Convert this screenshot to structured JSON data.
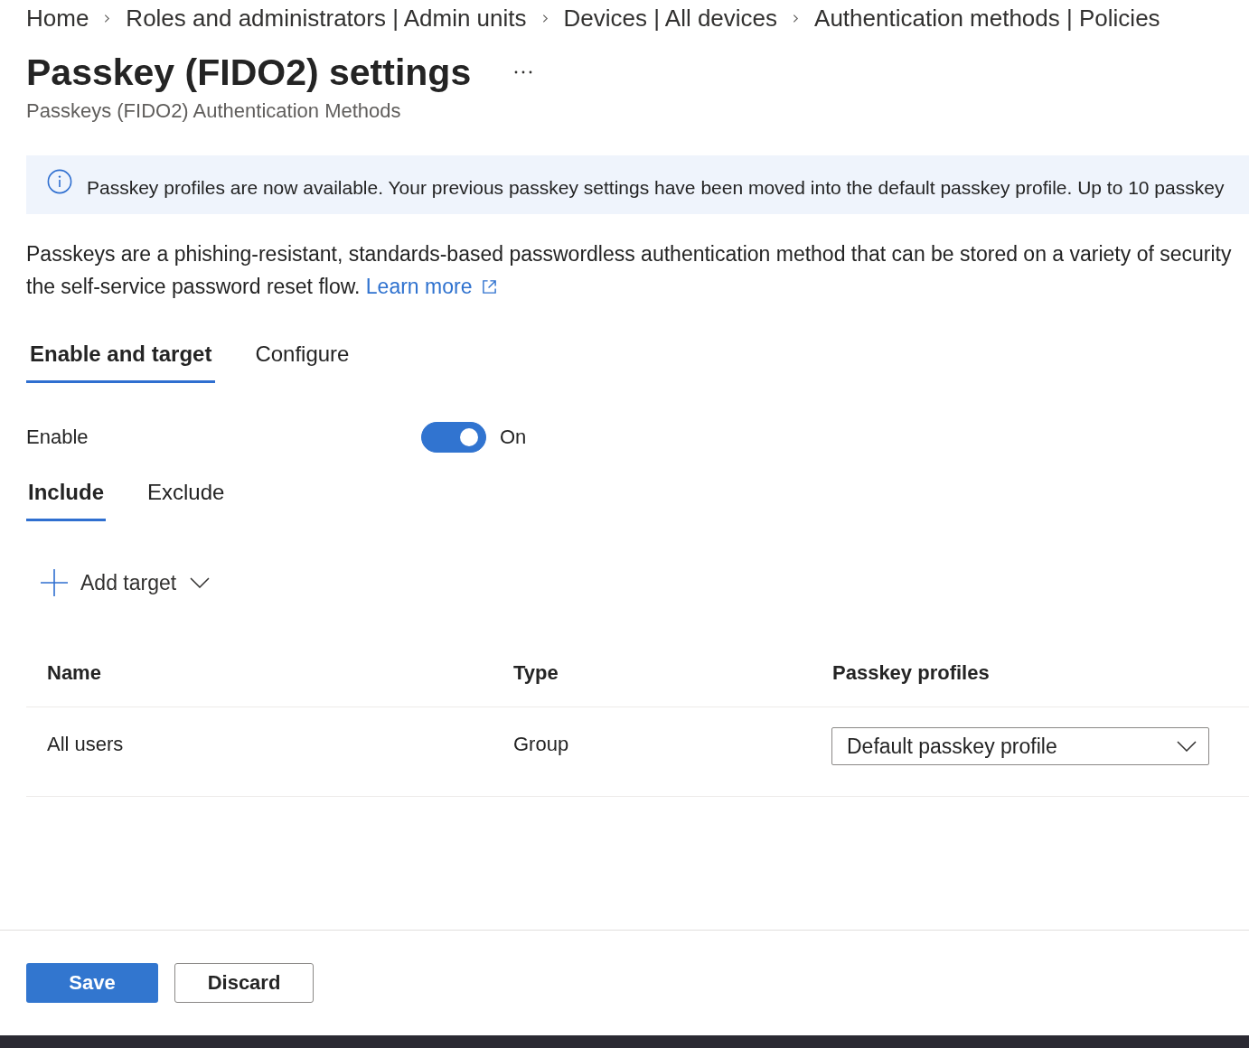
{
  "breadcrumb": [
    "Home",
    "Roles and administrators | Admin units",
    "Devices | All devices",
    "Authentication methods | Policies"
  ],
  "header": {
    "title": "Passkey (FIDO2) settings",
    "subtitle": "Passkeys (FIDO2) Authentication Methods"
  },
  "banner": {
    "kind": "info",
    "text": "Passkey profiles are now available. Your previous passkey settings have been moved into the default passkey profile. Up to 10 passkey"
  },
  "description": {
    "lines": [
      "Passkeys are a phishing-resistant, standards-based passwordless authentication method that can be stored on a variety of security",
      "the self-service password reset flow."
    ],
    "link": "Learn more"
  },
  "tabs": [
    {
      "label": "Enable and target",
      "selected": true
    },
    {
      "label": "Configure",
      "selected": false
    }
  ],
  "enable": {
    "label": "Enable",
    "on": true,
    "state_text": "On"
  },
  "target_tabs": [
    {
      "label": "Include",
      "selected": true
    },
    {
      "label": "Exclude",
      "selected": false
    }
  ],
  "add_target": {
    "label": "Add target"
  },
  "table": {
    "columns": [
      "Name",
      "Type",
      "Passkey profiles"
    ],
    "rows": [
      {
        "name": "All users",
        "type": "Group",
        "passkey_profile": "Default passkey profile"
      }
    ]
  },
  "buttons": [
    {
      "label": "Save",
      "kind": "primary"
    },
    {
      "label": "Discard",
      "kind": "secondary"
    }
  ]
}
